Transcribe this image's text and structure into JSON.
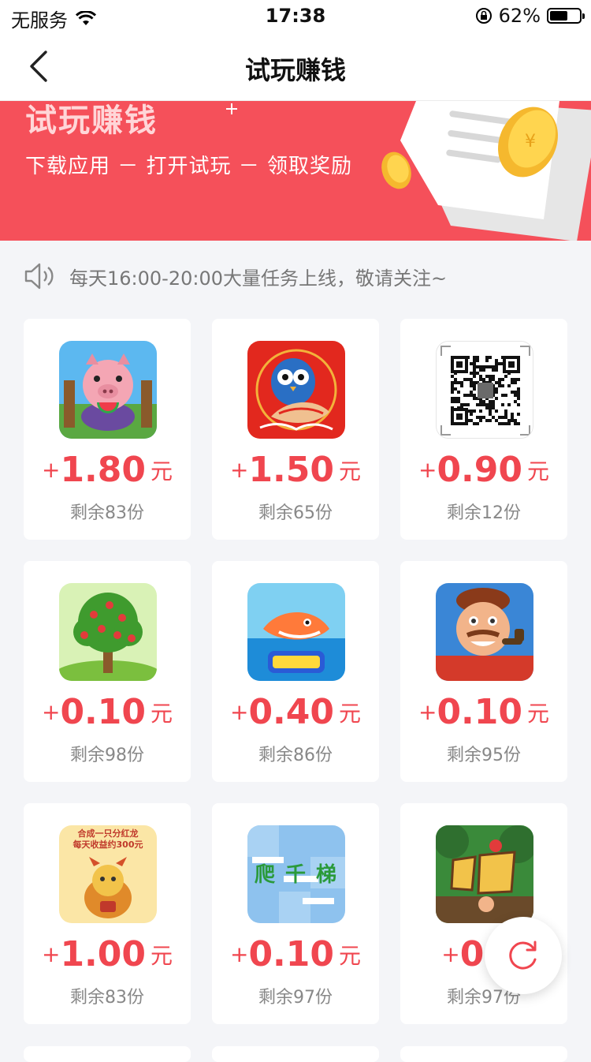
{
  "status": {
    "carrier": "无服务",
    "time": "17:38",
    "battery": "62%",
    "battery_level": 0.62
  },
  "nav": {
    "title": "试玩赚钱"
  },
  "banner": {
    "title": "试玩赚钱",
    "subtitle": "下载应用 － 打开试玩 － 领取奖励"
  },
  "notice": {
    "text": "每天16:00-20:00大量任务上线，敬请关注~"
  },
  "cards": [
    {
      "plus": "+",
      "amount": "1.80",
      "unit": "元",
      "remaining": "剩余83份",
      "icon": "pig-game-icon"
    },
    {
      "plus": "+",
      "amount": "1.50",
      "unit": "元",
      "remaining": "剩余65份",
      "icon": "owl-fish-icon"
    },
    {
      "plus": "+",
      "amount": "0.90",
      "unit": "元",
      "remaining": "剩余12份",
      "icon": "qr-code-icon"
    },
    {
      "plus": "+",
      "amount": "0.10",
      "unit": "元",
      "remaining": "剩余98份",
      "icon": "fruit-tree-icon"
    },
    {
      "plus": "+",
      "amount": "0.40",
      "unit": "元",
      "remaining": "剩余86份",
      "icon": "shark-game-icon"
    },
    {
      "plus": "+",
      "amount": "0.10",
      "unit": "元",
      "remaining": "剩余95份",
      "icon": "cartoon-man-icon"
    },
    {
      "plus": "+",
      "amount": "1.00",
      "unit": "元",
      "remaining": "剩余83份",
      "icon": "dragon-poster-icon"
    },
    {
      "plus": "+",
      "amount": "0.10",
      "unit": "元",
      "remaining": "剩余97份",
      "icon": "climb-game-icon"
    },
    {
      "plus": "+",
      "amount": "0.1",
      "unit": "",
      "remaining": "剩余97份",
      "icon": "jungle-game-icon"
    }
  ],
  "dragon_card_text": {
    "line1": "合成一只分红龙",
    "line2": "每天收益约300元"
  },
  "climb_card_text": "爬 千 梯",
  "colors": {
    "accent": "#f0464f",
    "banner": "#f5505a"
  }
}
